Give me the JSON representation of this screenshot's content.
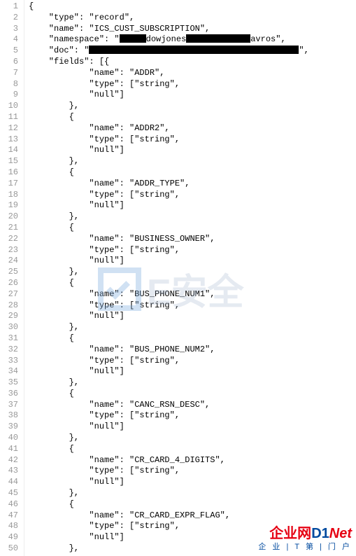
{
  "watermark_text": "E安全",
  "footer": {
    "brand_left": "企业网",
    "brand_right_d": "D1",
    "brand_right_net": "Net",
    "tagline": "企 业 | T 第 | 门 户"
  },
  "schema": {
    "type": "record",
    "name": "ICS_CUST_SUBSCRIPTION",
    "namespace_visible_fragments": [
      "dowjones",
      "avros"
    ],
    "doc_visible_fragments": [],
    "fields": [
      {
        "name": "ADDR",
        "type": [
          "string",
          "null"
        ]
      },
      {
        "name": "ADDR2",
        "type": [
          "string",
          "null"
        ]
      },
      {
        "name": "ADDR_TYPE",
        "type": [
          "string",
          "null"
        ]
      },
      {
        "name": "BUSINESS_OWNER",
        "type": [
          "string",
          "null"
        ]
      },
      {
        "name": "BUS_PHONE_NUM1",
        "type": [
          "string",
          "null"
        ]
      },
      {
        "name": "BUS_PHONE_NUM2",
        "type": [
          "string",
          "null"
        ]
      },
      {
        "name": "CANC_RSN_DESC",
        "type": [
          "string",
          "null"
        ]
      },
      {
        "name": "CR_CARD_4_DIGITS",
        "type": [
          "string",
          "null"
        ]
      },
      {
        "name": "CR_CARD_EXPR_FLAG",
        "type": [
          "string",
          "null"
        ]
      }
    ]
  },
  "lines": [
    {
      "n": 1,
      "indent": 0,
      "text": "{"
    },
    {
      "n": 2,
      "indent": 1,
      "key": "type",
      "val": "record",
      "comma": true
    },
    {
      "n": 3,
      "indent": 1,
      "key": "name",
      "val": "ICS_CUST_SUBSCRIPTION",
      "comma": true
    },
    {
      "n": 4,
      "indent": 1,
      "namespace_line": true
    },
    {
      "n": 5,
      "indent": 1,
      "doc_line": true
    },
    {
      "n": 6,
      "indent": 1,
      "key": "fields",
      "open_array": true
    },
    {
      "n": 7,
      "indent": 3,
      "key": "name",
      "val": "ADDR",
      "comma": true
    },
    {
      "n": 8,
      "indent": 3,
      "key": "type",
      "arr_open": "string",
      "comma": true
    },
    {
      "n": 9,
      "indent": 3,
      "arr_close": "null"
    },
    {
      "n": 10,
      "indent": 2,
      "close_obj": true
    },
    {
      "n": 11,
      "indent": 2,
      "open_obj": true
    },
    {
      "n": 12,
      "indent": 3,
      "key": "name",
      "val": "ADDR2",
      "comma": true
    },
    {
      "n": 13,
      "indent": 3,
      "key": "type",
      "arr_open": "string",
      "comma": true
    },
    {
      "n": 14,
      "indent": 3,
      "arr_close": "null"
    },
    {
      "n": 15,
      "indent": 2,
      "close_obj": true
    },
    {
      "n": 16,
      "indent": 2,
      "open_obj": true
    },
    {
      "n": 17,
      "indent": 3,
      "key": "name",
      "val": "ADDR_TYPE",
      "comma": true
    },
    {
      "n": 18,
      "indent": 3,
      "key": "type",
      "arr_open": "string",
      "comma": true
    },
    {
      "n": 19,
      "indent": 3,
      "arr_close": "null"
    },
    {
      "n": 20,
      "indent": 2,
      "close_obj": true
    },
    {
      "n": 21,
      "indent": 2,
      "open_obj": true
    },
    {
      "n": 22,
      "indent": 3,
      "key": "name",
      "val": "BUSINESS_OWNER",
      "comma": true
    },
    {
      "n": 23,
      "indent": 3,
      "key": "type",
      "arr_open": "string",
      "comma": true
    },
    {
      "n": 24,
      "indent": 3,
      "arr_close": "null"
    },
    {
      "n": 25,
      "indent": 2,
      "close_obj": true
    },
    {
      "n": 26,
      "indent": 2,
      "open_obj": true
    },
    {
      "n": 27,
      "indent": 3,
      "key": "name",
      "val": "BUS_PHONE_NUM1",
      "comma": true
    },
    {
      "n": 28,
      "indent": 3,
      "key": "type",
      "arr_open": "string",
      "comma": true
    },
    {
      "n": 29,
      "indent": 3,
      "arr_close": "null"
    },
    {
      "n": 30,
      "indent": 2,
      "close_obj": true
    },
    {
      "n": 31,
      "indent": 2,
      "open_obj": true
    },
    {
      "n": 32,
      "indent": 3,
      "key": "name",
      "val": "BUS_PHONE_NUM2",
      "comma": true
    },
    {
      "n": 33,
      "indent": 3,
      "key": "type",
      "arr_open": "string",
      "comma": true
    },
    {
      "n": 34,
      "indent": 3,
      "arr_close": "null"
    },
    {
      "n": 35,
      "indent": 2,
      "close_obj": true
    },
    {
      "n": 36,
      "indent": 2,
      "open_obj": true
    },
    {
      "n": 37,
      "indent": 3,
      "key": "name",
      "val": "CANC_RSN_DESC",
      "comma": true
    },
    {
      "n": 38,
      "indent": 3,
      "key": "type",
      "arr_open": "string",
      "comma": true
    },
    {
      "n": 39,
      "indent": 3,
      "arr_close": "null"
    },
    {
      "n": 40,
      "indent": 2,
      "close_obj": true
    },
    {
      "n": 41,
      "indent": 2,
      "open_obj": true
    },
    {
      "n": 42,
      "indent": 3,
      "key": "name",
      "val": "CR_CARD_4_DIGITS",
      "comma": true
    },
    {
      "n": 43,
      "indent": 3,
      "key": "type",
      "arr_open": "string",
      "comma": true
    },
    {
      "n": 44,
      "indent": 3,
      "arr_close": "null"
    },
    {
      "n": 45,
      "indent": 2,
      "close_obj": true
    },
    {
      "n": 46,
      "indent": 2,
      "open_obj": true
    },
    {
      "n": 47,
      "indent": 3,
      "key": "name",
      "val": "CR_CARD_EXPR_FLAG",
      "comma": true
    },
    {
      "n": 48,
      "indent": 3,
      "key": "type",
      "arr_open": "string",
      "comma": true
    },
    {
      "n": 49,
      "indent": 3,
      "arr_close": "null"
    },
    {
      "n": 50,
      "indent": 2,
      "close_obj": true
    }
  ]
}
